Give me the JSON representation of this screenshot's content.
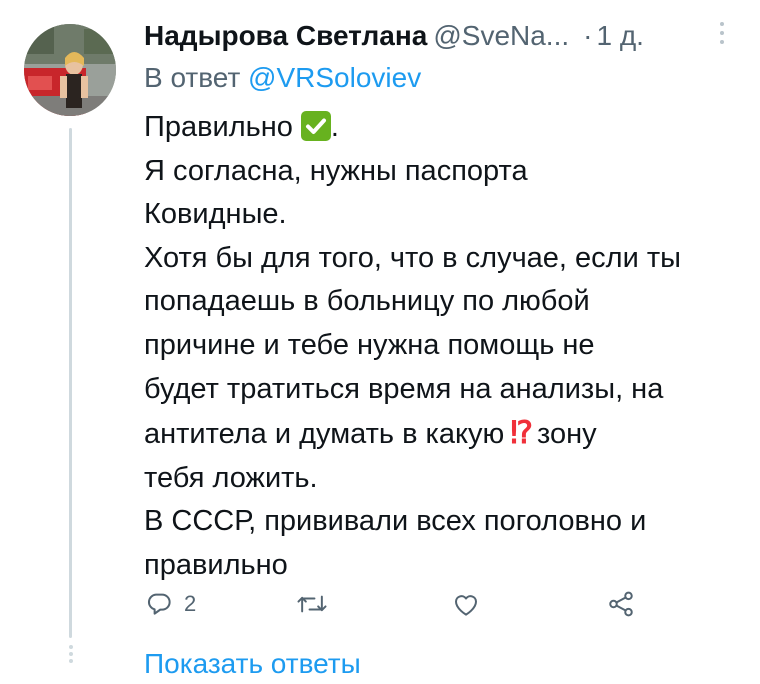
{
  "tweet": {
    "display_name": "Надырова Светлана",
    "handle": "@SveNa...",
    "separator": "·",
    "time": "1 д.",
    "reply_prefix": "В ответ",
    "reply_to": "@VRSoloviev",
    "body_lines": [
      "Правильно",
      "Я согласна, нужны паспорта",
      "Ковидные.",
      "Хотя бы для того, что в случае, если ты",
      "попадаешь в больницу по любой",
      "причине и тебе нужна помощь не",
      "будет тратиться время на анализы, на",
      "антитела и думать в какую",
      "тебя ложить.",
      "В СССР, прививали всех поголовно и",
      "правильно"
    ],
    "line1_suffix": ".",
    "line8_suffix": "зону",
    "emoji_check": "check-mark-button-emoji",
    "emoji_interrobang": "⁉",
    "actions": {
      "reply_count": "2"
    },
    "show_replies_label": "Показать ответы"
  },
  "colors": {
    "text": "#0f1419",
    "secondary": "#536471",
    "link": "#1d9bf0",
    "thread_line": "#cfd9de",
    "check_green": "#67b21f",
    "interrobang_red": "#f0303a"
  },
  "icons": [
    "reply-icon",
    "retweet-icon",
    "like-icon",
    "share-icon",
    "more-icon"
  ]
}
